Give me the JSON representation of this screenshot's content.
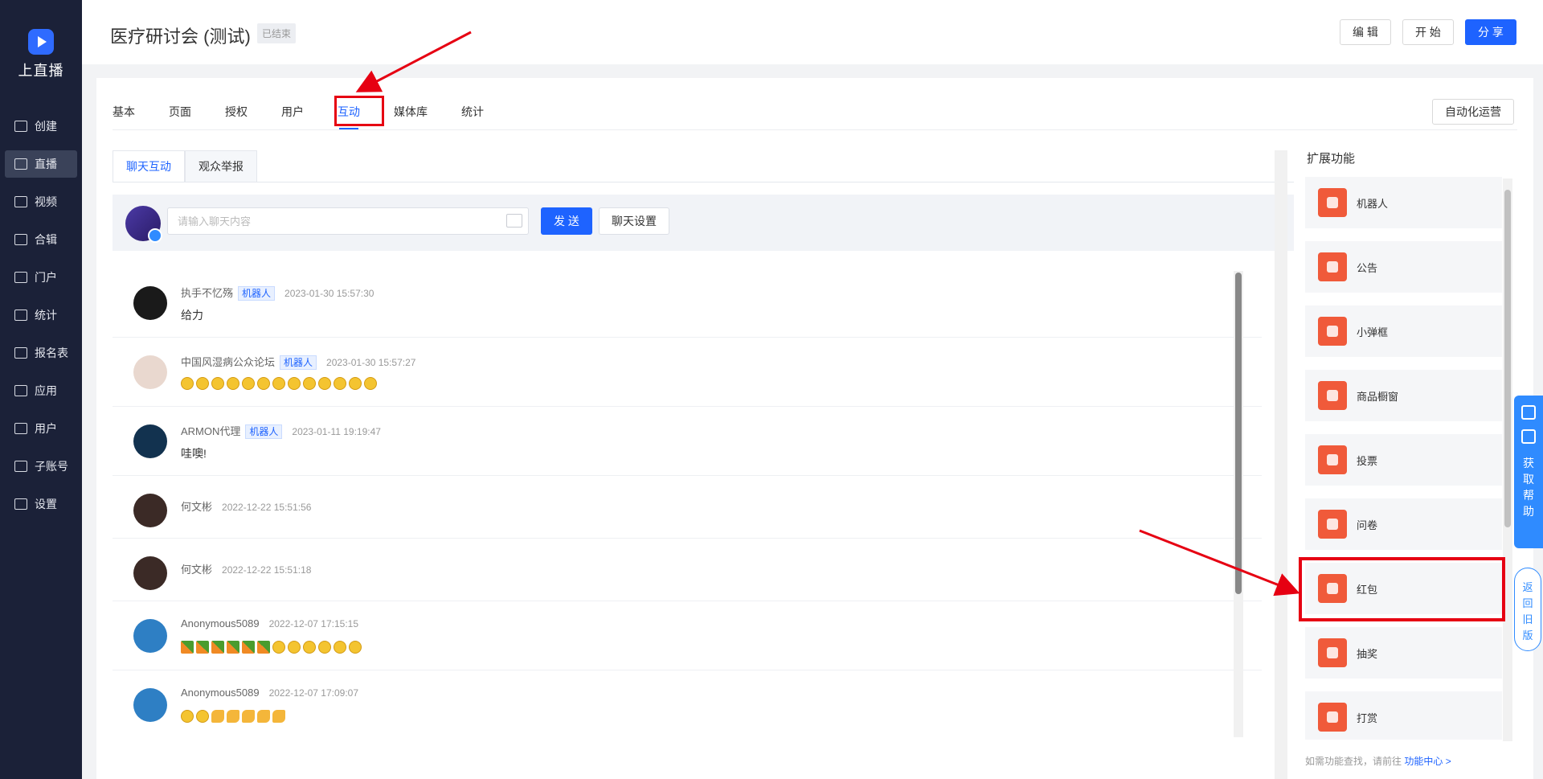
{
  "app": {
    "logo_text": "上直播"
  },
  "sidebar": {
    "items": [
      {
        "label": "创建",
        "icon": "plus-square-icon"
      },
      {
        "label": "直播",
        "icon": "video-icon",
        "active": true
      },
      {
        "label": "视频",
        "icon": "film-icon"
      },
      {
        "label": "合辑",
        "icon": "collection-icon"
      },
      {
        "label": "门户",
        "icon": "monitor-icon"
      },
      {
        "label": "统计",
        "icon": "pie-chart-icon"
      },
      {
        "label": "报名表",
        "icon": "form-icon"
      },
      {
        "label": "应用",
        "icon": "apps-icon"
      },
      {
        "label": "用户",
        "icon": "user-icon"
      },
      {
        "label": "子账号",
        "icon": "sub-account-icon"
      },
      {
        "label": "设置",
        "icon": "gear-icon"
      }
    ]
  },
  "header": {
    "title": "医疗研讨会 (测试)",
    "status_badge": "已结束",
    "edit_label": "编 辑",
    "start_label": "开 始",
    "share_label": "分 享"
  },
  "tabs": {
    "items": [
      "基本",
      "页面",
      "授权",
      "用户",
      "互动",
      "媒体库",
      "统计"
    ],
    "active": "互动",
    "auto_ops_label": "自动化运营"
  },
  "subtabs": {
    "items": [
      "聊天互动",
      "观众举报"
    ],
    "active": "聊天互动"
  },
  "chat_input": {
    "placeholder": "请输入聊天内容",
    "send_label": "发 送",
    "settings_label": "聊天设置"
  },
  "messages": [
    {
      "name": "执手不忆殇",
      "tag": "机器人",
      "time": "2023-01-30 15:57:30",
      "text": "给力",
      "emoji": []
    },
    {
      "name": "中国风湿病公众论坛",
      "tag": "机器人",
      "time": "2023-01-30 15:57:27",
      "text": "",
      "emoji": [
        "e",
        "e",
        "e",
        "e",
        "e",
        "e",
        "e",
        "e",
        "e",
        "e",
        "e",
        "e",
        "e"
      ]
    },
    {
      "name": "ARMON代理",
      "tag": "机器人",
      "time": "2023-01-11 19:19:47",
      "text": "哇噢!",
      "emoji": []
    },
    {
      "name": "何文彬",
      "tag": "",
      "time": "2022-12-22 15:51:56",
      "text": "",
      "emoji": []
    },
    {
      "name": "何文彬",
      "tag": "",
      "time": "2022-12-22 15:51:18",
      "text": "",
      "emoji": []
    },
    {
      "name": "Anonymous5089",
      "tag": "",
      "time": "2022-12-07 17:15:15",
      "text": "",
      "emoji": [
        "c",
        "c",
        "c",
        "c",
        "c",
        "c",
        "e",
        "e",
        "e",
        "e",
        "e",
        "e"
      ]
    },
    {
      "name": "Anonymous5089",
      "tag": "",
      "time": "2022-12-07 17:09:07",
      "text": "",
      "emoji": [
        "e",
        "e",
        "a",
        "a",
        "a",
        "a",
        "a"
      ]
    }
  ],
  "extensions": {
    "title": "扩展功能",
    "items": [
      "机器人",
      "公告",
      "小弹框",
      "商品橱窗",
      "投票",
      "问卷",
      "红包",
      "抽奖",
      "打赏"
    ],
    "hint": "如需功能查找，请前往",
    "hint_link": "功能中心 >"
  },
  "float": {
    "help_label": "获取帮助",
    "old_version_label": "返回旧版"
  },
  "colors": {
    "primary": "#1e63ff",
    "sidebar_bg": "#1b2138",
    "annotation_red": "#e60012",
    "ext_icon": "#f05a3a"
  }
}
